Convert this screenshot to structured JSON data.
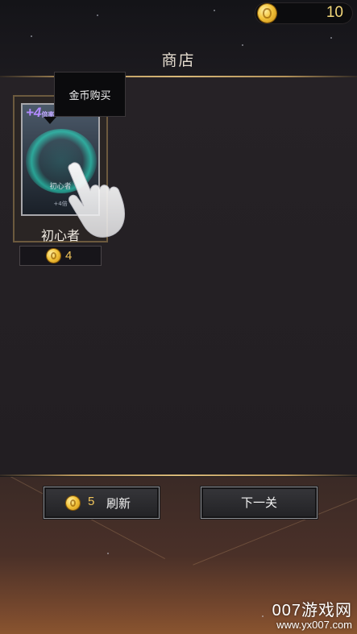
{
  "header": {
    "coin_count": "10",
    "title": "商店"
  },
  "shop": {
    "items": [
      {
        "name": "初心者",
        "art_badge": "+4",
        "art_badge_small": "倍率",
        "art_name": "初心者",
        "art_sub": "+4倍",
        "price": "4"
      }
    ]
  },
  "tooltip": {
    "text": "金币购买"
  },
  "footer": {
    "refresh_cost": "5",
    "refresh_label": "刷新",
    "next_label": "下一关"
  },
  "watermark": {
    "brand": "007游戏网",
    "url": "www.yx007.com"
  },
  "icons": {
    "coin": "coin-icon",
    "pointer": "hand-pointer-icon"
  },
  "colors": {
    "gold_text": "#f0c45a",
    "divider_gold": "#d8b878",
    "card_glow": "#28ffdc",
    "badge_purple": "#b28bff"
  }
}
